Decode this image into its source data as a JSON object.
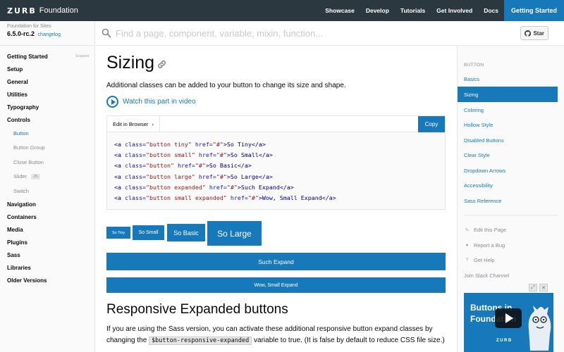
{
  "topbar": {
    "logo_mark": "ZURB",
    "logo_text": "Foundation",
    "nav": [
      "Showcase",
      "Develop",
      "Tutorials",
      "Get Involved",
      "Docs"
    ],
    "cta": "Getting Started"
  },
  "site": {
    "subtitle": "Foundation for Sites",
    "version": "6.5.0-rc.2",
    "changelog": "changelog"
  },
  "search": {
    "placeholder": "Find a page, component, variable, mixin, function..."
  },
  "github": {
    "star_label": "Star"
  },
  "sidebar": {
    "expand_label": "Expand",
    "items": [
      {
        "label": "Getting Started"
      },
      {
        "label": "Setup"
      },
      {
        "label": "General"
      },
      {
        "label": "Utilities"
      },
      {
        "label": "Typography"
      },
      {
        "label": "Controls"
      }
    ],
    "sub_items": [
      {
        "label": "Button"
      },
      {
        "label": "Button Group"
      },
      {
        "label": "Close Button"
      },
      {
        "label": "Slider",
        "badge": "JS"
      },
      {
        "label": "Switch"
      }
    ],
    "items_after": [
      {
        "label": "Navigation"
      },
      {
        "label": "Containers"
      },
      {
        "label": "Media"
      },
      {
        "label": "Plugins"
      },
      {
        "label": "Sass"
      },
      {
        "label": "Libraries"
      },
      {
        "label": "Older Versions"
      }
    ]
  },
  "main": {
    "title": "Sizing",
    "intro": "Additional classes can be added to your button to change its size and shape.",
    "video_link": "Watch this part in video",
    "edit_browser": "Edit in Browser",
    "edit_arrow": "›",
    "copy": "Copy",
    "code_lines": [
      [
        "<a ",
        "class=",
        "\"button tiny\"",
        " href=",
        "\"#\"",
        ">So Tiny</a>"
      ],
      [
        "<a ",
        "class=",
        "\"button small\"",
        " href=",
        "\"#\"",
        ">So Small</a>"
      ],
      [
        "<a ",
        "class=",
        "\"button\"",
        " href=",
        "\"#\"",
        ">So Basic</a>"
      ],
      [
        "<a ",
        "class=",
        "\"button large\"",
        " href=",
        "\"#\"",
        ">So Large</a>"
      ],
      [
        "<a ",
        "class=",
        "\"button expanded\"",
        " href=",
        "\"#\"",
        ">Such Expand</a>"
      ],
      [
        "<a ",
        "class=",
        "\"button small expanded\"",
        " href=",
        "\"#\"",
        ">Wow, Small Expand</a>"
      ]
    ],
    "buttons": {
      "tiny": "So Tiny",
      "small": "So Small",
      "basic": "So Basic",
      "large": "So Large",
      "expand": "Such Expand",
      "small_expand": "Wow, Small Expand"
    },
    "h2": "Responsive Expanded buttons",
    "para_1": "If you are using the Sass version, you can activate these additional responsive button expand classes by changing the ",
    "para_code": "$button-responsive-expanded",
    "para_2": " variable to true. (It is false by default to reduce CSS file size.)"
  },
  "toc": {
    "heading": "BUTTON",
    "items": [
      "Basics",
      "Sizing",
      "Coloring",
      "Hollow Style",
      "Disabled Buttons",
      "Clear Style",
      "Dropdown Arrows",
      "Accessibility",
      "Sass Reference"
    ],
    "active_index": 1,
    "extras": [
      {
        "icon": "pencil-icon",
        "label": "Edit this Page"
      },
      {
        "icon": "github-icon",
        "label": "Report a Bug"
      },
      {
        "icon": "question-icon",
        "label": "Get Help"
      },
      {
        "icon": "",
        "label": "Join Slack Channel"
      }
    ]
  },
  "video_thumb": {
    "title": "Buttons in Foundation",
    "brand": "ZURB"
  },
  "colors": {
    "primary": "#1779ba",
    "topbar": "#2c3840",
    "sidebar_bg": "#fafafa"
  }
}
